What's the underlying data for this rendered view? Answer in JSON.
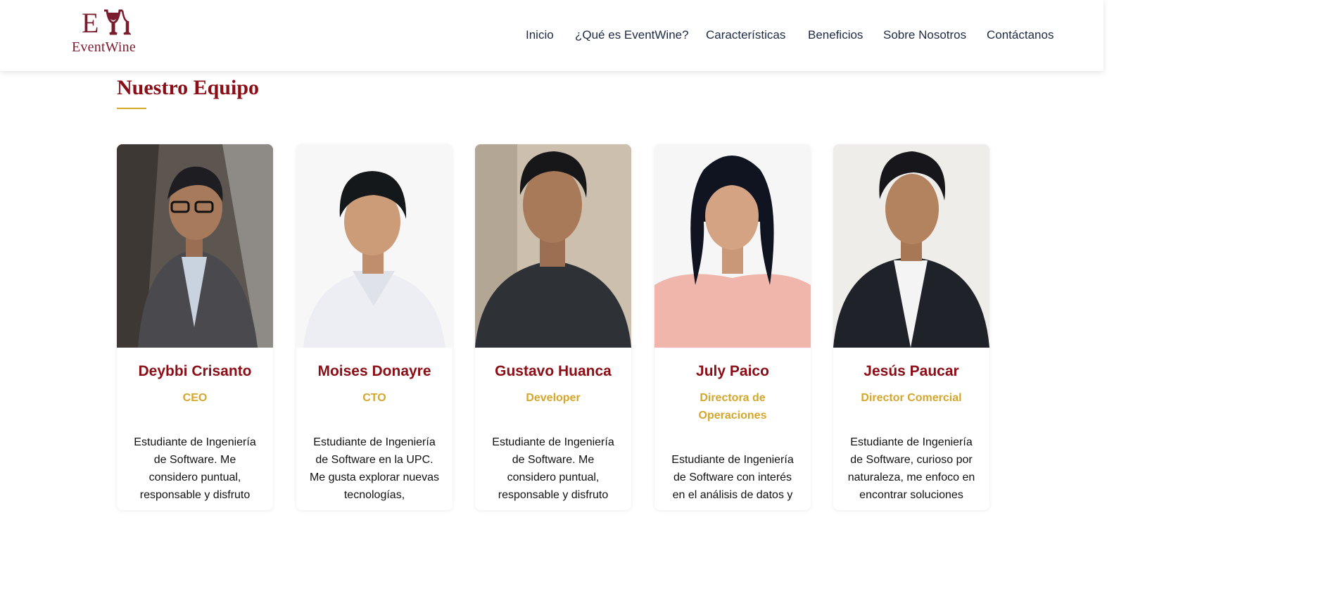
{
  "brand": {
    "name": "EventWine",
    "monogram": "EW",
    "color": "#7a1c2e"
  },
  "nav": {
    "items": [
      {
        "label": "Inicio"
      },
      {
        "label": "¿Qué es EventWine?"
      },
      {
        "label": "Características"
      },
      {
        "label": "Beneficios"
      },
      {
        "label": "Sobre Nosotros"
      },
      {
        "label": "Contáctanos"
      }
    ]
  },
  "team": {
    "title": "Nuestro Equipo",
    "members": [
      {
        "name": "Deybbi Crisanto",
        "role": "CEO",
        "bio": "Estudiante de Ingeniería de Software. Me considero puntual, responsable y disfruto"
      },
      {
        "name": "Moises Donayre",
        "role": "CTO",
        "bio": "Estudiante de Ingeniería de Software en la UPC. Me gusta explorar nuevas tecnologías,"
      },
      {
        "name": "Gustavo Huanca",
        "role": "Developer",
        "bio": "Estudiante de Ingeniería de Software. Me considero puntual, responsable y disfruto"
      },
      {
        "name": "July Paico",
        "role": "Directora de Operaciones",
        "bio": "Estudiante de Ingeniería de Software con interés en el análisis de datos y"
      },
      {
        "name": "Jesús Paucar",
        "role": "Director Comercial",
        "bio": "Estudiante de Ingeniería de Software, curioso por naturaleza, me enfoco en encontrar soluciones"
      }
    ]
  },
  "colors": {
    "accent_red": "#8b0d16",
    "accent_gold": "#d4a72c",
    "nav_text": "#1d2a44"
  }
}
